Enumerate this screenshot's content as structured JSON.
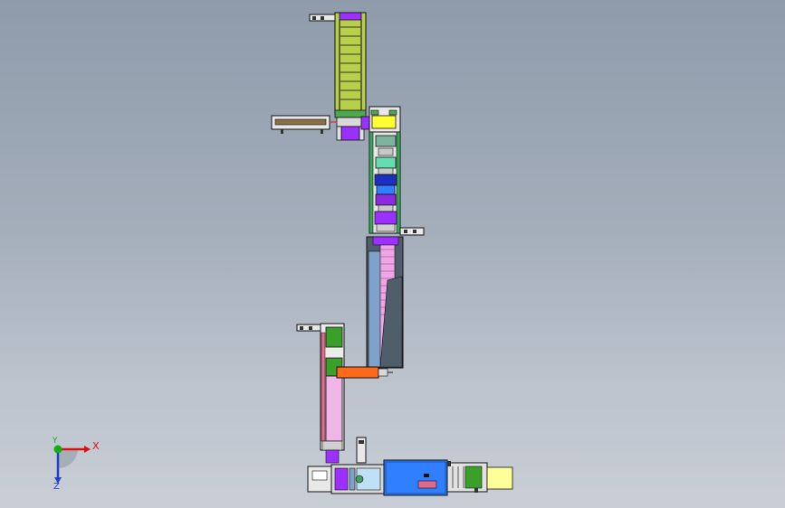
{
  "triad": {
    "x_label": "X",
    "y_label": "Y",
    "z_label": "Z",
    "x_color": "#e01010",
    "y_color": "#10b010",
    "z_color": "#2040d0"
  },
  "colors": {
    "background_top": "#8f9bab",
    "background_bottom": "#c9ced6",
    "conveyor_green": "#9acd32",
    "accent_purple": "#9b30ff",
    "accent_yellow": "#ffff33",
    "accent_orange": "#ff6a1a",
    "accent_blue": "#2f7fff",
    "accent_pink": "#f0a6e6",
    "dark_slate": "#4f5e6b"
  }
}
